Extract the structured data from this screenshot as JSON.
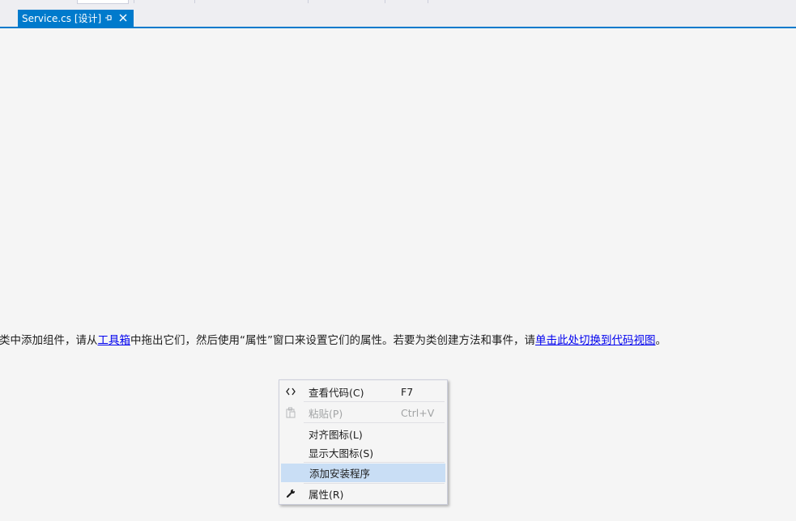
{
  "tab": {
    "title": "Service.cs [设计]",
    "pin_icon": "pin-icon",
    "close_icon": "close-icon",
    "accent_color": "#007acc"
  },
  "hint": {
    "prefix": "类中添加组件，请从",
    "toolbox_link": "工具箱",
    "middle": "中拖出它们，然后使用“属性”窗口来设置它们的属性。若要为类创建方法和事件，请",
    "code_view_link": "单击此处切换到代码视图",
    "suffix": "。"
  },
  "context_menu": {
    "items": [
      {
        "label": "查看代码(C)",
        "shortcut": "F7",
        "icon": "code-brackets-icon",
        "enabled": true
      },
      {
        "label": "粘贴(P)",
        "shortcut": "Ctrl+V",
        "icon": "paste-icon",
        "enabled": false
      },
      {
        "label": "对齐图标(L)",
        "shortcut": "",
        "icon": "",
        "enabled": true
      },
      {
        "label": "显示大图标(S)",
        "shortcut": "",
        "icon": "",
        "enabled": true
      },
      {
        "label": "添加安装程序",
        "shortcut": "",
        "icon": "",
        "enabled": true,
        "highlighted": true
      },
      {
        "label": "属性(R)",
        "shortcut": "",
        "icon": "wrench-icon",
        "enabled": true
      }
    ],
    "highlight_color": "#c9def5"
  }
}
